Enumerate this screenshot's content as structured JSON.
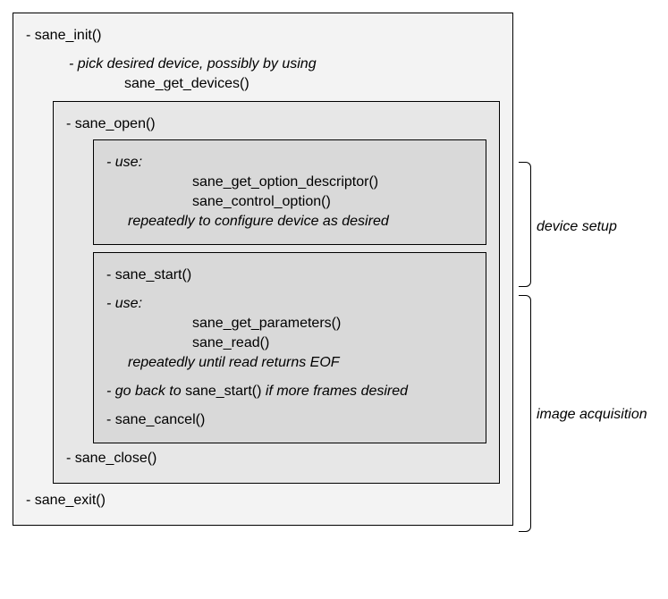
{
  "outer": {
    "init": "sane_init()",
    "pick_note": "pick desired device, possibly by using",
    "get_devices": "sane_get_devices()",
    "exit": "sane_exit()"
  },
  "open_box": {
    "open": "sane_open()",
    "close": "sane_close()",
    "setup": {
      "use_label": "use:",
      "opt_desc": "sane_get_option_descriptor()",
      "ctrl_opt": "sane_control_option()",
      "note": "repeatedly to configure device as desired"
    },
    "acq": {
      "start": "sane_start()",
      "use_label": "use:",
      "get_params": "sane_get_parameters()",
      "read": "sane_read()",
      "note_eof": "repeatedly until read returns EOF",
      "goback_pre": "go back to ",
      "goback_fn": "sane_start()",
      "goback_post": " if more frames desired",
      "cancel": "sane_cancel()"
    }
  },
  "labels": {
    "setup": "device setup",
    "acquisition": "image acquisition"
  }
}
